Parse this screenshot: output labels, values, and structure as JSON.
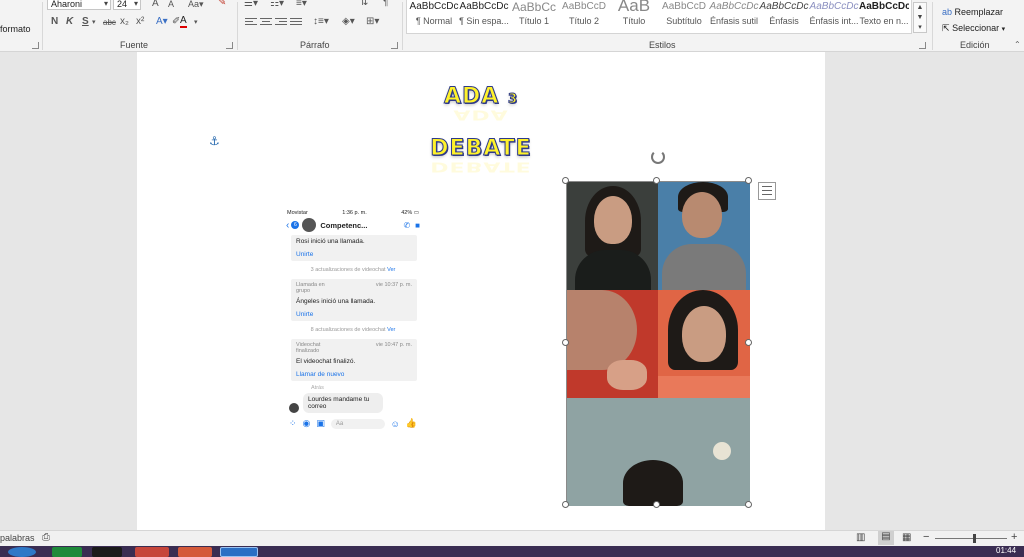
{
  "ribbon": {
    "clipboard": {
      "format_label": "formato"
    },
    "font": {
      "group_label": "Fuente",
      "font_name": "Aharoni",
      "font_size": "24",
      "buttons": [
        "N",
        "K",
        "S",
        "abc",
        "x₂",
        "x²"
      ]
    },
    "paragraph": {
      "group_label": "Párrafo"
    },
    "styles": {
      "group_label": "Estilos",
      "items": [
        {
          "preview": "AaBbCcDc",
          "name": "¶ Normal"
        },
        {
          "preview": "AaBbCcDc",
          "name": "¶ Sin espa..."
        },
        {
          "preview": "AaBbCc",
          "name": "Título 1"
        },
        {
          "preview": "AaBbCcD",
          "name": "Título 2"
        },
        {
          "preview": "AaB",
          "name": "Título"
        },
        {
          "preview": "AaBbCcD",
          "name": "Subtítulo"
        },
        {
          "preview": "AaBbCcDc",
          "name": "Énfasis sutil"
        },
        {
          "preview": "AaBbCcDc",
          "name": "Énfasis"
        },
        {
          "preview": "AaBbCcDc",
          "name": "Énfasis int..."
        },
        {
          "preview": "AaBbCcDc",
          "name": "Texto en n..."
        }
      ]
    },
    "editing": {
      "group_label": "Edición",
      "replace": "Reemplazar",
      "select": "Seleccionar"
    }
  },
  "document": {
    "title_main": "ADA",
    "title_num": "3",
    "subtitle": "DEBATE"
  },
  "messenger": {
    "status": {
      "carrier": "Movistar",
      "time": "1:36 p. m.",
      "battery": "42%"
    },
    "badge": "6",
    "chat_name": "Competenc...",
    "cards": [
      {
        "meta_left": "",
        "meta_right": "",
        "text": "Rosi inició una llamada.",
        "link": "Unirte"
      },
      {
        "meta_left": "Llamada en grupo",
        "meta_right": "vie 10:37 p. m.",
        "text": "Ángeles inició una llamada.",
        "link": "Unirte"
      },
      {
        "meta_left": "Videochat finalizado",
        "meta_right": "vie 10:47 p. m.",
        "text": "El videochat finalizó.",
        "link": "Llamar de nuevo"
      }
    ],
    "updates": [
      {
        "text": "3 actualizaciones de videochat",
        "link": "Ver"
      },
      {
        "text": "8 actualizaciones de videochat",
        "link": "Ver"
      }
    ],
    "seen_label": "Atrás",
    "message": "Lourdes mandame tu correo",
    "input_placeholder": "Aa"
  },
  "statusbar": {
    "words": "palabras",
    "time": "01:44"
  },
  "colors": {
    "accent": "#2b579a",
    "title_fill": "#fff22a",
    "title_stroke": "#2e3a8a",
    "taskbar": "#3a2d52"
  }
}
